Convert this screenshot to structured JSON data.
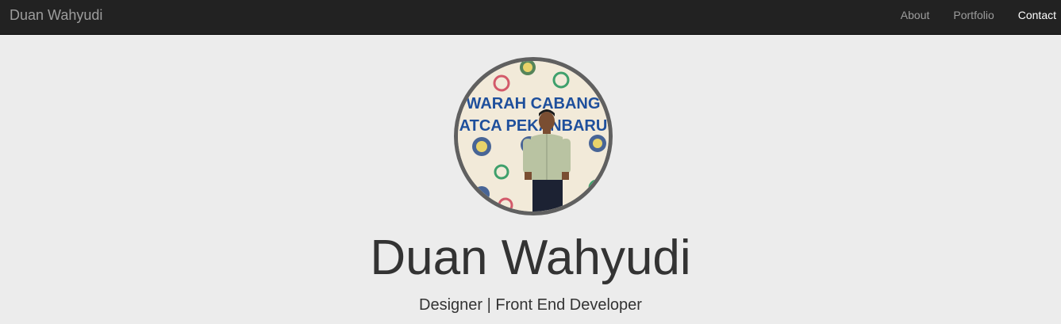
{
  "navbar": {
    "brand": "Duan Wahyudi",
    "items": [
      {
        "label": "About"
      },
      {
        "label": "Portfolio"
      },
      {
        "label": "Contact"
      }
    ],
    "active_item": "Contact"
  },
  "profile": {
    "photo_banner_line1": "WARAH CABANG",
    "photo_banner_line2": "ATCA PEKANBARU",
    "name": "Duan Wahyudi",
    "tagline": "Designer | Front End Developer"
  },
  "colors": {
    "navbar_bg": "#222222",
    "nav_text": "#9d9d9d",
    "nav_active_text": "#ffffff",
    "page_bg": "#ececec",
    "avatar_border": "#606060",
    "heading_text": "#333333"
  }
}
